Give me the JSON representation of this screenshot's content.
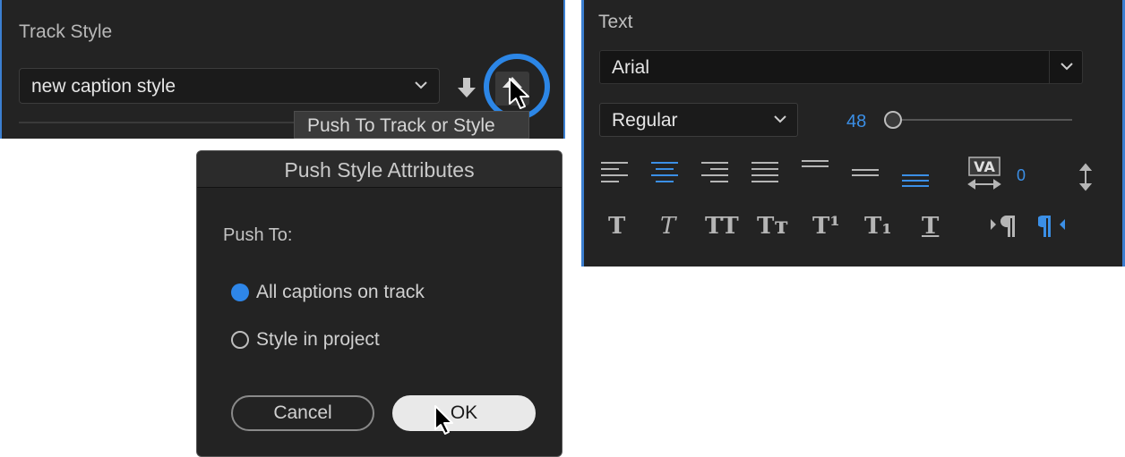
{
  "track_style": {
    "title": "Track Style",
    "selected_style": "new caption style",
    "pull_button_icon": "arrow-down-icon",
    "push_button_icon": "arrow-up-icon",
    "tooltip": "Push To Track or Style"
  },
  "dialog": {
    "title": "Push Style Attributes",
    "push_to_label": "Push To:",
    "options": [
      {
        "label": "All captions on track",
        "selected": true
      },
      {
        "label": "Style in project",
        "selected": false
      }
    ],
    "cancel_label": "Cancel",
    "ok_label": "OK"
  },
  "text_panel": {
    "title": "Text",
    "font": "Arial",
    "weight": "Regular",
    "size": "48",
    "size_slider_fraction": 0.0,
    "tracking_value": "0",
    "alignment_active": "align-center",
    "vertical_align_active": "align-bottom",
    "text_direction_active": "rtl",
    "style_buttons": [
      "T",
      "T",
      "TT",
      "Tт",
      "T¹",
      "T₁",
      "T"
    ]
  },
  "colors": {
    "accent": "#2c86e6",
    "panel_bg": "#232323",
    "value_blue": "#3b8fe6"
  }
}
